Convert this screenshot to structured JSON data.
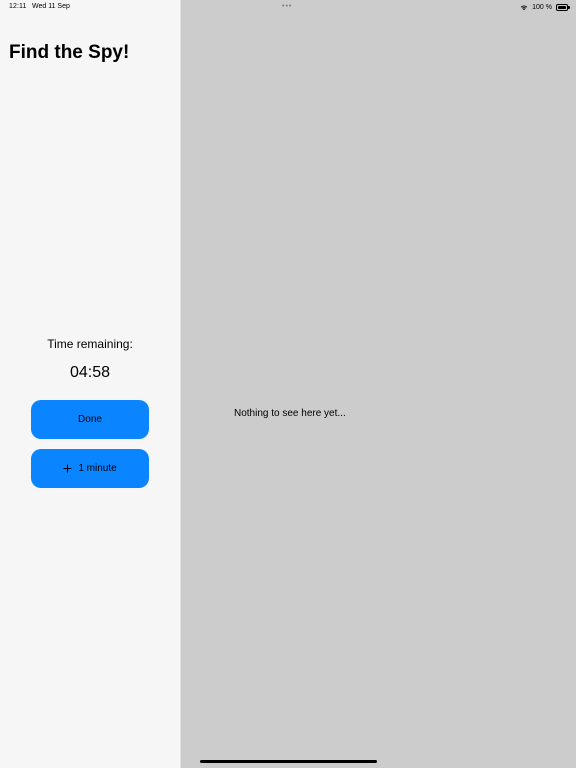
{
  "status_bar": {
    "time": "12:11",
    "date": "Wed 11 Sep",
    "multitask_dots": "•••",
    "battery_percent": "100 %",
    "battery_level": 1.0,
    "icons": [
      "wifi-icon",
      "battery-icon"
    ]
  },
  "sidebar": {
    "title": "Find the Spy!",
    "timer_label": "Time remaining:",
    "timer_value": "04:58",
    "done_button": "Done",
    "add_minute_button": "1 minute",
    "add_minute_icon": "plus-icon"
  },
  "detail": {
    "empty_message": "Nothing to see here yet..."
  },
  "colors": {
    "accent": "#0a84ff",
    "sidebar_background": "#f6f6f7",
    "detail_background": "#cccccc"
  }
}
